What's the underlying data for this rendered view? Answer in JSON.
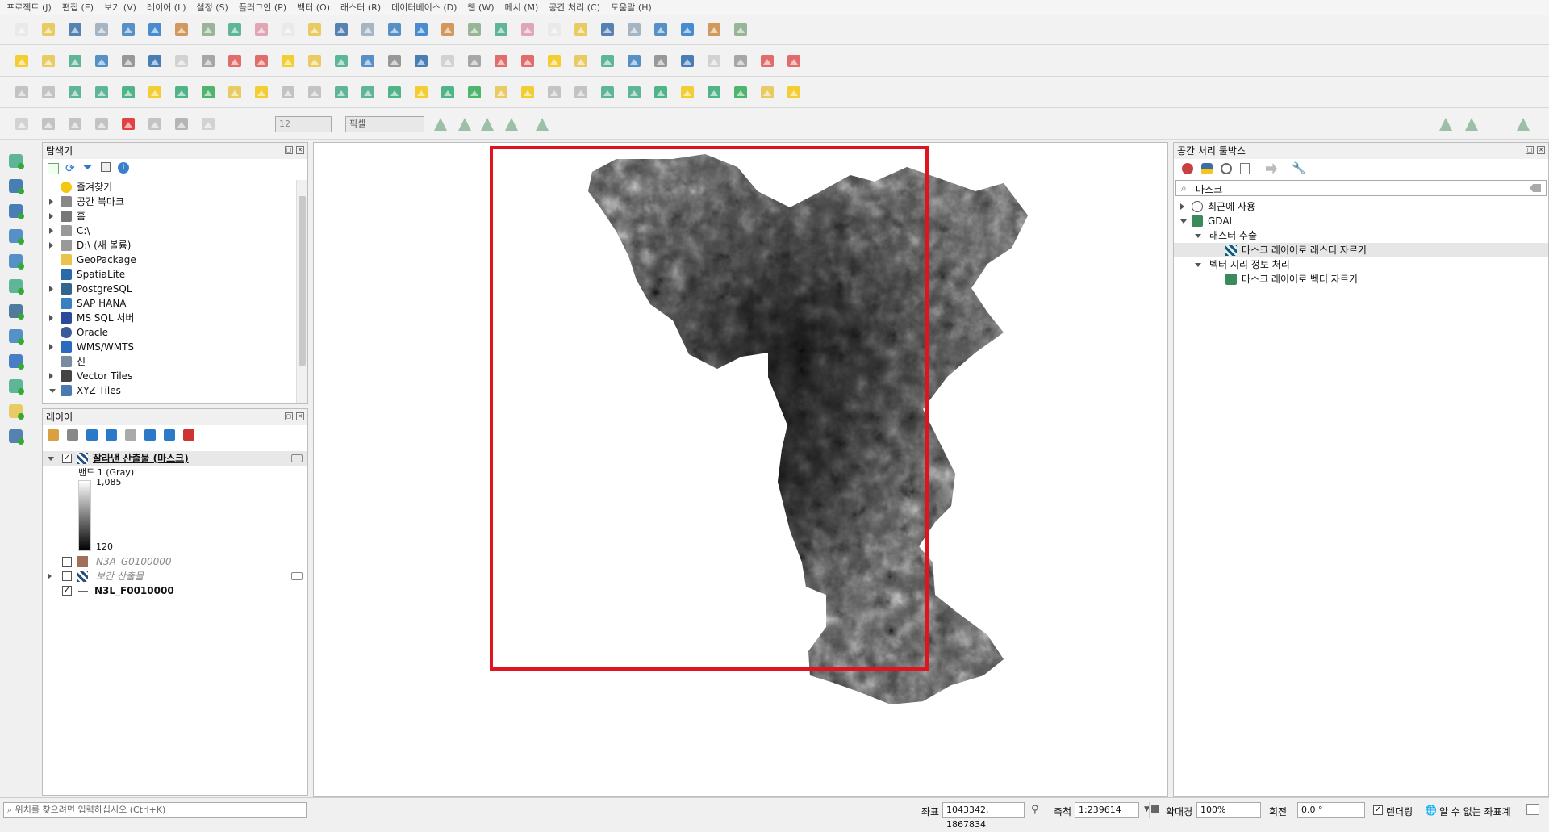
{
  "menu": [
    "프로젝트 (J)",
    "편집 (E)",
    "보기 (V)",
    "레이어 (L)",
    "설정 (S)",
    "플러그인 (P)",
    "벡터 (O)",
    "래스터 (R)",
    "데이터베이스 (D)",
    "웹 (W)",
    "메시 (M)",
    "공간 처리 (C)",
    "도움말 (H)"
  ],
  "digitizing": {
    "snap_tolerance": "12",
    "unit": "픽셀"
  },
  "browser": {
    "title": "탐색기",
    "items": [
      {
        "label": "즐겨찾기",
        "icon": "star-icon"
      },
      {
        "label": "공간 북마크",
        "icon": "bookmark-icon"
      },
      {
        "label": "홈",
        "icon": "home-icon"
      },
      {
        "label": "C:\\",
        "icon": "folder-icon"
      },
      {
        "label": "D:\\ (새 볼륨)",
        "icon": "folder-icon"
      },
      {
        "label": "GeoPackage",
        "icon": "geopackage-icon"
      },
      {
        "label": "SpatiaLite",
        "icon": "spatialite-icon"
      },
      {
        "label": "PostgreSQL",
        "icon": "postgresql-icon"
      },
      {
        "label": "SAP HANA",
        "icon": "hana-icon"
      },
      {
        "label": "MS SQL 서버",
        "icon": "mssql-icon"
      },
      {
        "label": "Oracle",
        "icon": "oracle-icon"
      },
      {
        "label": "WMS/WMTS",
        "icon": "wms-icon"
      },
      {
        "label": "신",
        "icon": "scene-icon"
      },
      {
        "label": "Vector Tiles",
        "icon": "vector-tiles-icon"
      },
      {
        "label": "XYZ Tiles",
        "icon": "xyz-tiles-icon"
      }
    ]
  },
  "layers": {
    "title": "레이어",
    "main_layer": "잘라낸 산출물 (마스크)",
    "band": "밴드 1 (Gray)",
    "max": "1,085",
    "min": "120",
    "layer2": "N3A_G0100000",
    "layer3": "보간 산출물",
    "layer4": "N3L_F0010000"
  },
  "toolbox": {
    "title": "공간 처리 툴박스",
    "search": "마스크",
    "recent": "최근에 사용",
    "provider": "GDAL",
    "group1": "래스터 추출",
    "alg1": "마스크 레이어로 래스터 자르기",
    "group2": "벡터 지리 정보 처리",
    "alg2": "마스크 레이어로 벡터 자르기"
  },
  "status": {
    "locator_placeholder": "위치를 찾으려면 입력하십시오 (Ctrl+K)",
    "coord_label": "좌표",
    "coord": "1043342, 1867834",
    "scale_label": "축척",
    "scale": "1:239614",
    "magnifier_label": "확대경",
    "magnifier": "100%",
    "rotation_label": "회전",
    "rotation": "0.0 °",
    "render": "렌더링",
    "crs": "알 수 없는 좌표계"
  },
  "colors": {
    "highlight": "#e0141e",
    "canvas": "#ffffff"
  }
}
